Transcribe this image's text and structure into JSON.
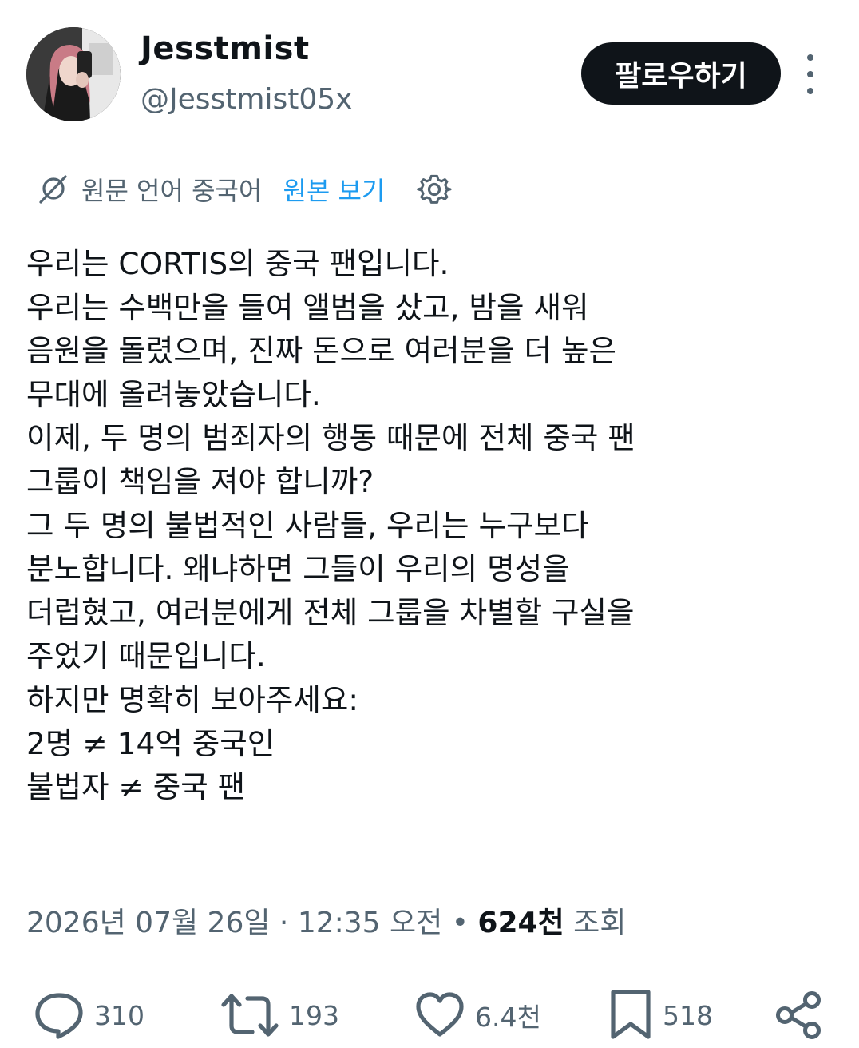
{
  "author": {
    "display_name": "Jesstmist",
    "handle": "@Jesstmist05x",
    "avatar_icon": "avatar-photo"
  },
  "follow_label": "팔로우하기",
  "translation": {
    "original_language": "원문 언어 중국어",
    "show_original": "원본 보기"
  },
  "tweet": {
    "lines": [
      "우리는 CORTIS의 중국 팬입니다.",
      "우리는 수백만을 들여 앨범을 샀고, 밤을 새워",
      "음원을 돌렸으며, 진짜 돈으로 여러분을 더 높은",
      "무대에 올려놓았습니다.",
      "이제, 두 명의 범죄자의 행동 때문에 전체 중국 팬",
      "그룹이 책임을 져야 합니까?",
      "그 두 명의 불법적인 사람들, 우리는 누구보다",
      "분노합니다. 왜냐하면 그들이 우리의 명성을",
      "더럽혔고, 여러분에게 전체 그룹을 차별할 구실을",
      "주었기 때문입니다.",
      "하지만 명확히 보아주세요:",
      "2명 ≠ 14억 중국인",
      "불법자 ≠ 중국 팬"
    ]
  },
  "meta": {
    "date": "2026년 07월 26일",
    "separator": " · ",
    "time": "12:35 오전",
    "dot": " • ",
    "views_count": "624천",
    "views_label": " 조회"
  },
  "actions": {
    "replies": "310",
    "reposts": "193",
    "likes": "6.4천",
    "bookmarks": "518"
  },
  "colors": {
    "text": "#0f1419",
    "secondary": "#536471",
    "link": "#1d9bf0",
    "follow_bg": "#0f1419"
  }
}
